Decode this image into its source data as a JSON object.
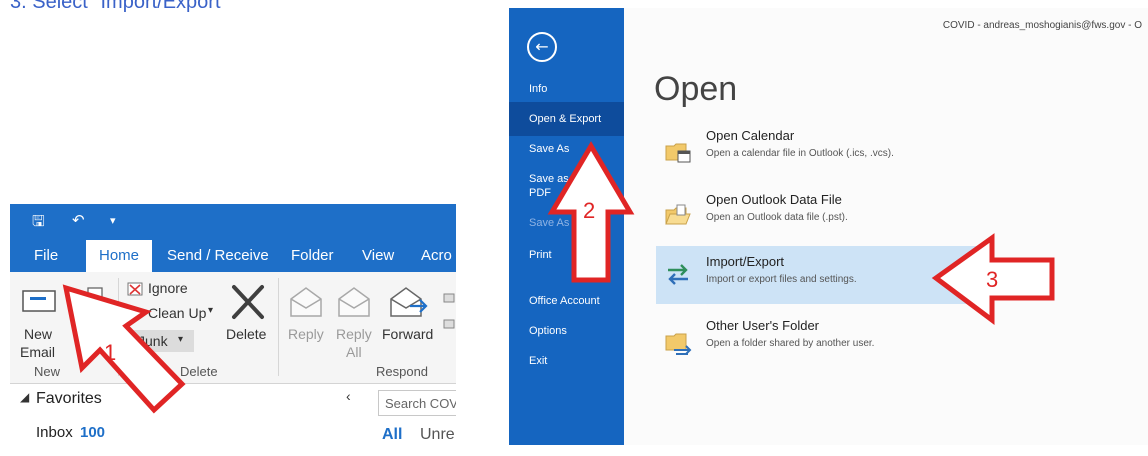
{
  "instruction": "3.  Select \"Import/Export\"",
  "outlook": {
    "tabs": [
      "File",
      "Home",
      "Send / Receive",
      "Folder",
      "View",
      "Acro"
    ],
    "ribbon": {
      "new_email": [
        "New",
        "Email"
      ],
      "ignore": "Ignore",
      "clean_up": "Clean Up",
      "junk": "Junk",
      "delete": "Delete",
      "reply": "Reply",
      "reply_all": [
        "Reply",
        "All"
      ],
      "forward": "Forward",
      "groups": [
        "New",
        "Delete",
        "Respond"
      ]
    },
    "nav": {
      "favorites": "Favorites",
      "inbox": "Inbox",
      "inbox_count": "100",
      "search_placeholder": "Search COV",
      "filter_all": "All",
      "filter_unread": "Unre"
    }
  },
  "backstage": {
    "account": "COVID - andreas_moshogianis@fws.gov - O",
    "menu": [
      "Info",
      "Open & Export",
      "Save As",
      "Save as PDF",
      "Save As",
      "Print",
      "Office Account",
      "Options",
      "Exit"
    ],
    "title": "Open",
    "options": [
      {
        "title": "Open Calendar",
        "desc": "Open a calendar file in Outlook (.ics, .vcs)."
      },
      {
        "title": "Open Outlook Data File",
        "desc": "Open an Outlook data file (.pst)."
      },
      {
        "title": "Import/Export",
        "desc": "Import or export files and settings."
      },
      {
        "title": "Other User's Folder",
        "desc": "Open a folder shared by another user."
      }
    ]
  },
  "annotations": [
    "1",
    "2",
    "3"
  ],
  "colors": {
    "ribbon_blue": "#1e6fc8",
    "backstage_blue": "#1565c0",
    "highlight": "#cde3f6",
    "arrow_red": "#e02525"
  }
}
